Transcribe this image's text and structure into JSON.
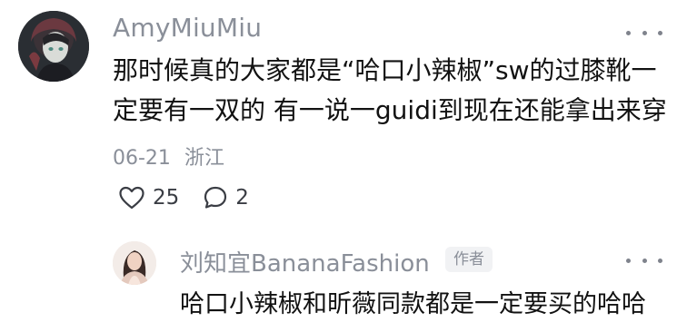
{
  "comment": {
    "username": "AmyMiuMiu",
    "text": "那时候真的大家都是“哈口小辣椒”sw的过膝靴一定要有一双的 有一说一guidi到现在还能拿出来穿",
    "date": "06-21",
    "location": "浙江",
    "likes": "25",
    "replies": "2",
    "more_icon": "more-horizontal-icon"
  },
  "reply": {
    "username": "刘知宜BananaFashion",
    "badge": "作者",
    "text": "哈口小辣椒和昕薇同款都是一定要买的哈哈",
    "more_icon": "more-horizontal-icon"
  },
  "colors": {
    "secondary_text": "#8a8f99",
    "primary_text": "#121212",
    "badge_bg": "#f1f2f4"
  }
}
